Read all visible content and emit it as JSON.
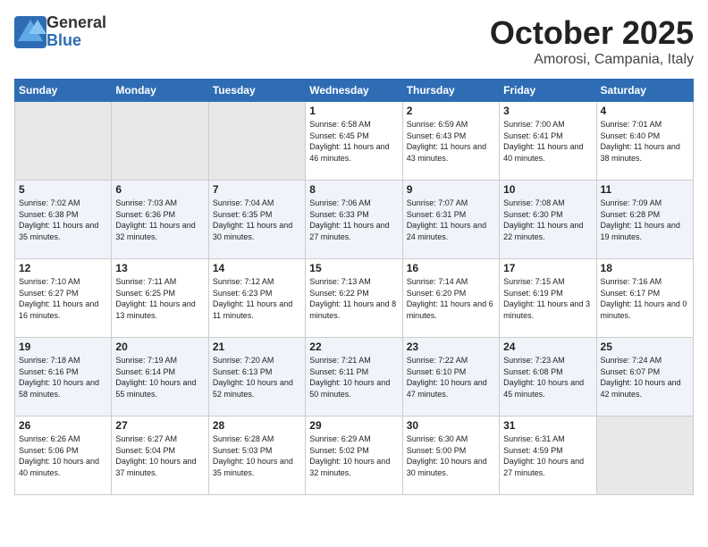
{
  "header": {
    "logo_general": "General",
    "logo_blue": "Blue",
    "month": "October 2025",
    "location": "Amorosi, Campania, Italy"
  },
  "calendar": {
    "days_of_week": [
      "Sunday",
      "Monday",
      "Tuesday",
      "Wednesday",
      "Thursday",
      "Friday",
      "Saturday"
    ],
    "weeks": [
      [
        {
          "day": "",
          "empty": true
        },
        {
          "day": "",
          "empty": true
        },
        {
          "day": "",
          "empty": true
        },
        {
          "day": "1",
          "sunrise": "6:58 AM",
          "sunset": "6:45 PM",
          "daylight": "11 hours and 46 minutes."
        },
        {
          "day": "2",
          "sunrise": "6:59 AM",
          "sunset": "6:43 PM",
          "daylight": "11 hours and 43 minutes."
        },
        {
          "day": "3",
          "sunrise": "7:00 AM",
          "sunset": "6:41 PM",
          "daylight": "11 hours and 40 minutes."
        },
        {
          "day": "4",
          "sunrise": "7:01 AM",
          "sunset": "6:40 PM",
          "daylight": "11 hours and 38 minutes."
        }
      ],
      [
        {
          "day": "5",
          "sunrise": "7:02 AM",
          "sunset": "6:38 PM",
          "daylight": "11 hours and 35 minutes."
        },
        {
          "day": "6",
          "sunrise": "7:03 AM",
          "sunset": "6:36 PM",
          "daylight": "11 hours and 32 minutes."
        },
        {
          "day": "7",
          "sunrise": "7:04 AM",
          "sunset": "6:35 PM",
          "daylight": "11 hours and 30 minutes."
        },
        {
          "day": "8",
          "sunrise": "7:06 AM",
          "sunset": "6:33 PM",
          "daylight": "11 hours and 27 minutes."
        },
        {
          "day": "9",
          "sunrise": "7:07 AM",
          "sunset": "6:31 PM",
          "daylight": "11 hours and 24 minutes."
        },
        {
          "day": "10",
          "sunrise": "7:08 AM",
          "sunset": "6:30 PM",
          "daylight": "11 hours and 22 minutes."
        },
        {
          "day": "11",
          "sunrise": "7:09 AM",
          "sunset": "6:28 PM",
          "daylight": "11 hours and 19 minutes."
        }
      ],
      [
        {
          "day": "12",
          "sunrise": "7:10 AM",
          "sunset": "6:27 PM",
          "daylight": "11 hours and 16 minutes."
        },
        {
          "day": "13",
          "sunrise": "7:11 AM",
          "sunset": "6:25 PM",
          "daylight": "11 hours and 13 minutes."
        },
        {
          "day": "14",
          "sunrise": "7:12 AM",
          "sunset": "6:23 PM",
          "daylight": "11 hours and 11 minutes."
        },
        {
          "day": "15",
          "sunrise": "7:13 AM",
          "sunset": "6:22 PM",
          "daylight": "11 hours and 8 minutes."
        },
        {
          "day": "16",
          "sunrise": "7:14 AM",
          "sunset": "6:20 PM",
          "daylight": "11 hours and 6 minutes."
        },
        {
          "day": "17",
          "sunrise": "7:15 AM",
          "sunset": "6:19 PM",
          "daylight": "11 hours and 3 minutes."
        },
        {
          "day": "18",
          "sunrise": "7:16 AM",
          "sunset": "6:17 PM",
          "daylight": "11 hours and 0 minutes."
        }
      ],
      [
        {
          "day": "19",
          "sunrise": "7:18 AM",
          "sunset": "6:16 PM",
          "daylight": "10 hours and 58 minutes."
        },
        {
          "day": "20",
          "sunrise": "7:19 AM",
          "sunset": "6:14 PM",
          "daylight": "10 hours and 55 minutes."
        },
        {
          "day": "21",
          "sunrise": "7:20 AM",
          "sunset": "6:13 PM",
          "daylight": "10 hours and 52 minutes."
        },
        {
          "day": "22",
          "sunrise": "7:21 AM",
          "sunset": "6:11 PM",
          "daylight": "10 hours and 50 minutes."
        },
        {
          "day": "23",
          "sunrise": "7:22 AM",
          "sunset": "6:10 PM",
          "daylight": "10 hours and 47 minutes."
        },
        {
          "day": "24",
          "sunrise": "7:23 AM",
          "sunset": "6:08 PM",
          "daylight": "10 hours and 45 minutes."
        },
        {
          "day": "25",
          "sunrise": "7:24 AM",
          "sunset": "6:07 PM",
          "daylight": "10 hours and 42 minutes."
        }
      ],
      [
        {
          "day": "26",
          "sunrise": "6:26 AM",
          "sunset": "5:06 PM",
          "daylight": "10 hours and 40 minutes."
        },
        {
          "day": "27",
          "sunrise": "6:27 AM",
          "sunset": "5:04 PM",
          "daylight": "10 hours and 37 minutes."
        },
        {
          "day": "28",
          "sunrise": "6:28 AM",
          "sunset": "5:03 PM",
          "daylight": "10 hours and 35 minutes."
        },
        {
          "day": "29",
          "sunrise": "6:29 AM",
          "sunset": "5:02 PM",
          "daylight": "10 hours and 32 minutes."
        },
        {
          "day": "30",
          "sunrise": "6:30 AM",
          "sunset": "5:00 PM",
          "daylight": "10 hours and 30 minutes."
        },
        {
          "day": "31",
          "sunrise": "6:31 AM",
          "sunset": "4:59 PM",
          "daylight": "10 hours and 27 minutes."
        },
        {
          "day": "",
          "empty": true
        }
      ]
    ]
  }
}
